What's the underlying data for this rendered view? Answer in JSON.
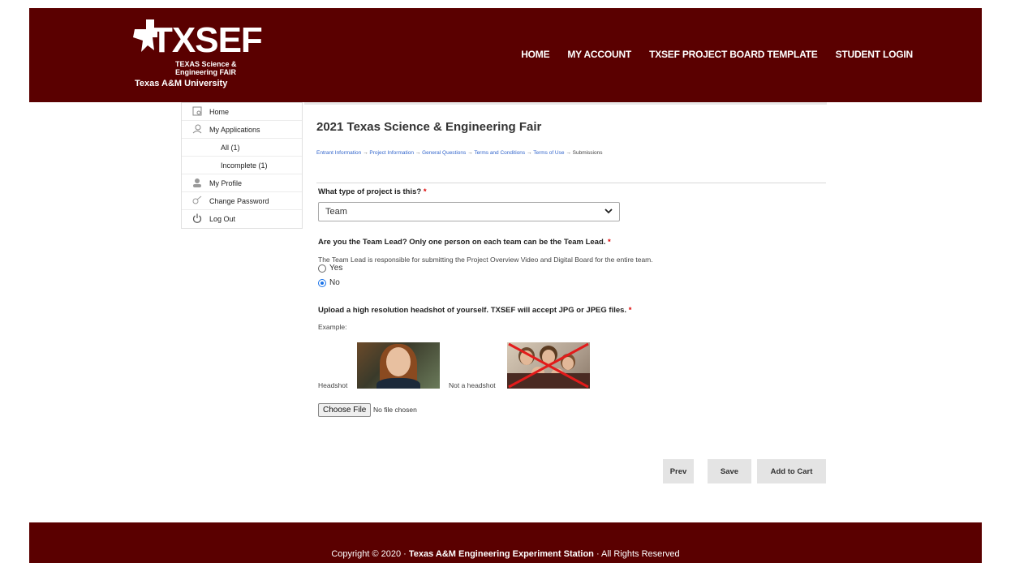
{
  "brand": {
    "logo_text": "TXSEF",
    "logo_sub1": "TEXAS Science &",
    "logo_sub2": "Engineering FAIR",
    "university": "Texas A&M University"
  },
  "nav": [
    "HOME",
    "MY ACCOUNT",
    "TXSEF PROJECT BOARD TEMPLATE",
    "STUDENT LOGIN"
  ],
  "sidebar": {
    "items": [
      {
        "label": "Home",
        "icon": "home-icon",
        "sub": false
      },
      {
        "label": "My Applications",
        "icon": "applications-icon",
        "sub": false
      },
      {
        "label": "All (1)",
        "icon": "",
        "sub": true
      },
      {
        "label": "Incomplete (1)",
        "icon": "",
        "sub": true
      },
      {
        "label": "My Profile",
        "icon": "profile-icon",
        "sub": false
      },
      {
        "label": "Change Password",
        "icon": "key-icon",
        "sub": false
      },
      {
        "label": "Log Out",
        "icon": "power-icon",
        "sub": false
      }
    ]
  },
  "page": {
    "title": "2021 Texas Science & Engineering Fair",
    "breadcrumb": [
      "Entrant Information",
      "Project Information",
      "General Questions",
      "Terms and Conditions",
      "Terms of Use",
      "Submissions"
    ],
    "breadcrumb_sep": "→"
  },
  "form": {
    "q1": "What type of project is this?",
    "q1_value": "Team",
    "q2": "Are you the Team Lead? Only one person on each team can be the Team Lead.",
    "q2_help": "The Team Lead is responsible for submitting the Project Overview Video and Digital Board for the entire team.",
    "q2_options": [
      "Yes",
      "No"
    ],
    "q2_selected": "No",
    "q3": "Upload a high resolution headshot of yourself. TXSEF will accept JPG or JPEG files.",
    "example_label": "Example:",
    "headshot_label": "Headshot",
    "not_headshot_label": "Not a headshot",
    "choose_file": "Choose File",
    "no_file": "No file chosen",
    "required_mark": "*"
  },
  "buttons": {
    "prev": "Prev",
    "save": "Save",
    "add_to_cart": "Add to Cart"
  },
  "footer": {
    "prefix": "Copyright © 2020 · ",
    "org": "Texas A&M Engineering Experiment Station",
    "suffix": " · All Rights Reserved"
  },
  "colors": {
    "brand": "#5a0000",
    "required": "#dd0000",
    "link": "#3366cc",
    "radio": "#1a73e8"
  }
}
